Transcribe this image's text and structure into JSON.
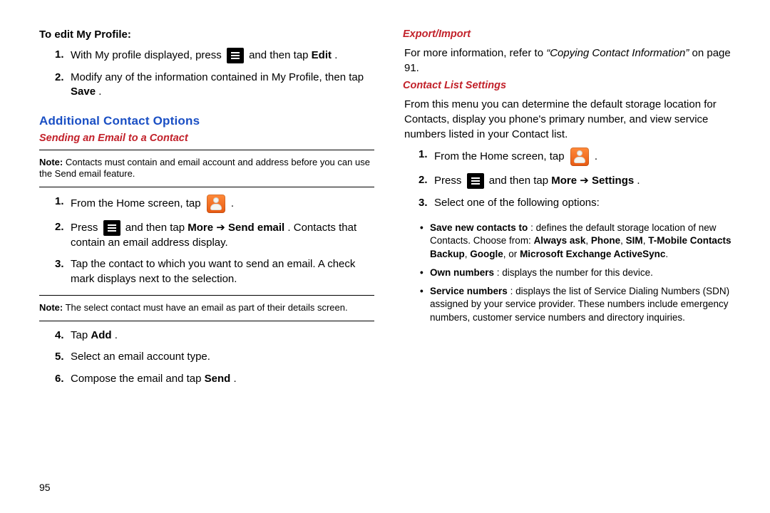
{
  "left": {
    "editProfileHeading": "To edit My Profile:",
    "edit1_a": "With My profile displayed, press ",
    "edit1_b": " and then tap ",
    "edit1_bold": "Edit",
    "edit1_c": ".",
    "edit2_a": "Modify any of the information contained in My Profile, then tap ",
    "edit2_bold": "Save",
    "edit2_b": ".",
    "additionalHeading": "Additional Contact Options",
    "sendingHeading": "Sending an Email to a Contact",
    "note1_label": "Note:",
    "note1_text": " Contacts must contain and email account and address before you can use the Send email feature.",
    "s1": "From the Home screen, tap ",
    "s1_b": " .",
    "s2_a": "Press ",
    "s2_b": " and then tap ",
    "s2_bold1": "More",
    "s2_arrow": " ➔ ",
    "s2_bold2": "Send email",
    "s2_c": ". Contacts that contain an email address display.",
    "s3": "Tap the contact to which you want to send an email. A check mark displays next to the selection.",
    "note2_label": "Note:",
    "note2_text": " The select contact must have an email as part of their details screen.",
    "s4_a": "Tap ",
    "s4_bold": "Add",
    "s4_b": ".",
    "s5": "Select an email account type.",
    "s6_a": "Compose the email and tap ",
    "s6_bold": "Send",
    "s6_b": "."
  },
  "right": {
    "exportHeading": "Export/Import",
    "export_a": "For more information, refer to ",
    "export_ref": "“Copying Contact Information”",
    "export_b": "  on page 91.",
    "clsHeading": "Contact List Settings",
    "clsIntro": "From this menu you can determine the default storage location for Contacts, display you phone's primary number, and view service numbers listed in your Contact list.",
    "c1_a": "From the Home screen, tap ",
    "c1_b": " .",
    "c2_a": "Press ",
    "c2_b": " and then tap ",
    "c2_bold1": "More",
    "c2_arrow": " ➔ ",
    "c2_bold2": "Settings",
    "c2_c": ".",
    "c3": "Select one of the following options:",
    "b1_lead": "Save new contacts to",
    "b1_a": ": defines the default storage location of new Contacts. Choose from: ",
    "b1_o1": "Always ask",
    "b1_s1": ", ",
    "b1_o2": "Phone",
    "b1_s2": ", ",
    "b1_o3": "SIM",
    "b1_s3": ", ",
    "b1_o4": "T-Mobile Contacts Backup",
    "b1_s4": ", ",
    "b1_o5": "Google",
    "b1_s5": ", or ",
    "b1_o6": "Microsoft Exchange ActiveSync",
    "b1_s6": ".",
    "b2_lead": "Own numbers",
    "b2_a": ": displays the number for this device.",
    "b3_lead": "Service numbers",
    "b3_a": ": displays the list of Service Dialing Numbers (SDN) assigned by your service provider. These numbers include emergency numbers, customer service numbers and directory inquiries."
  },
  "pageNumber": "95"
}
